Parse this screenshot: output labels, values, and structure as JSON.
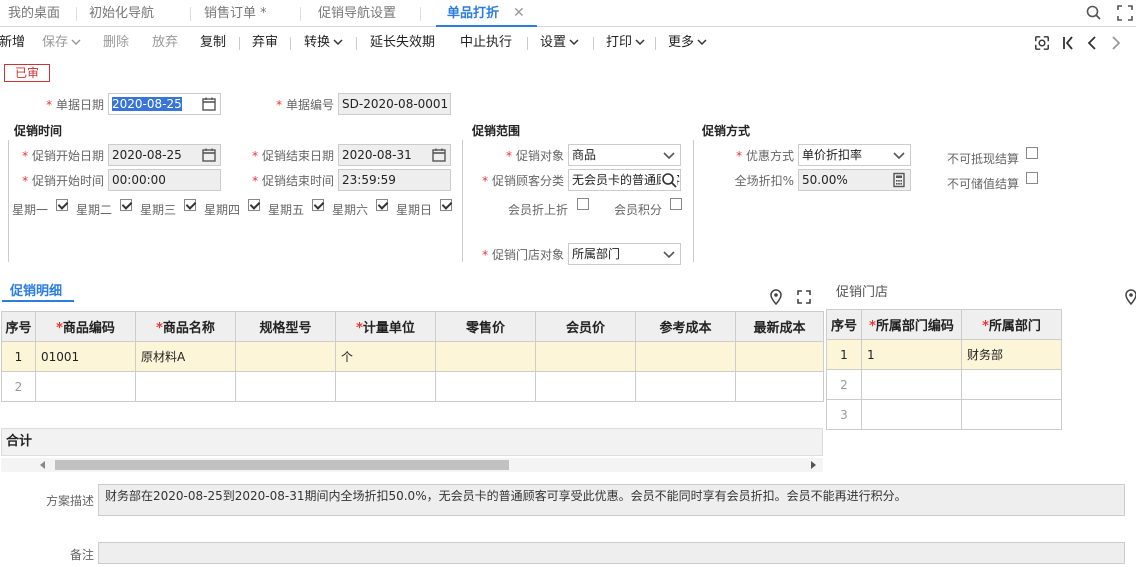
{
  "tabs": [
    {
      "label": "我的桌面"
    },
    {
      "label": "初始化导航"
    },
    {
      "label": "销售订单 *"
    },
    {
      "label": "促销导航设置"
    },
    {
      "label": "单品打折"
    }
  ],
  "tab_close_glyph": "✕",
  "toolbar": {
    "new": "新增",
    "save": "保存",
    "delete": "删除",
    "abandon": "放弃",
    "copy": "复制",
    "void": "弃审",
    "convert": "转换",
    "extend": "延长失效期",
    "stop": "中止执行",
    "settings": "设置",
    "print": "打印",
    "more": "更多"
  },
  "status_stamp": "已审",
  "header": {
    "doc_date_label": "单据日期",
    "doc_date": "2020-08-25",
    "doc_no_label": "单据编号",
    "doc_no": "SD-2020-08-0001"
  },
  "time_section": {
    "title": "促销时间",
    "start_date_label": "促销开始日期",
    "start_date": "2020-08-25",
    "end_date_label": "促销结束日期",
    "end_date": "2020-08-31",
    "start_time_label": "促销开始时间",
    "start_time": "00:00:00",
    "end_time_label": "促销结束时间",
    "end_time": "23:59:59",
    "weekdays": [
      "星期一",
      "星期二",
      "星期三",
      "星期四",
      "星期五",
      "星期六",
      "星期日"
    ]
  },
  "scope_section": {
    "title": "促销范围",
    "target_label": "促销对象",
    "target": "商品",
    "customer_label": "促销顾客分类",
    "customer": "无会员卡的普通顾客",
    "member_discount_label": "会员折上折",
    "member_points_label": "会员积分",
    "store_target_label": "促销门店对象",
    "store_target": "所属部门"
  },
  "method_section": {
    "title": "促销方式",
    "discount_type_label": "优惠方式",
    "discount_type": "单价折扣率",
    "rate_label": "全场折扣%",
    "rate": "50.00%",
    "no_cash_label": "不可抵现结算",
    "no_stored_label": "不可储值结算"
  },
  "detail_tab": "促销明细",
  "detail_columns": [
    "序号",
    "商品编码",
    "商品名称",
    "规格型号",
    "计量单位",
    "零售价",
    "会员价",
    "参考成本",
    "最新成本"
  ],
  "detail_rows": [
    [
      "1",
      "01001",
      "原材料A",
      "",
      "个",
      "",
      "",
      "",
      ""
    ],
    [
      "2",
      "",
      "",
      "",
      "",
      "",
      "",
      "",
      ""
    ]
  ],
  "summary_label": "合计",
  "store_panel_title": "促销门店",
  "store_columns": [
    "序号",
    "所属部门编码",
    "所属部门"
  ],
  "store_rows": [
    [
      "1",
      "1",
      "财务部"
    ],
    [
      "2",
      "",
      ""
    ],
    [
      "3",
      "",
      ""
    ]
  ],
  "plan_desc_label": "方案描述",
  "plan_desc": "财务部在2020-08-25到2020-08-31期间内全场折扣50.0%，无会员卡的普通顾客可享受此优惠。会员不能同时享有会员折扣。会员不能再进行积分。",
  "remark_label": "备注",
  "colors": {
    "accent": "#2b7de1",
    "required": "#e33",
    "stamp": "#c33",
    "selected_row": "#fdf5d8"
  }
}
